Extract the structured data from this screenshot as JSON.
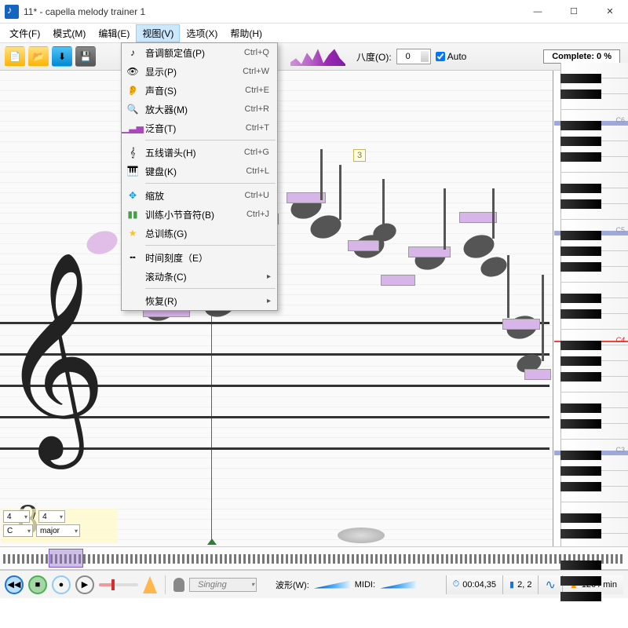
{
  "window": {
    "title": "11* - capella melody trainer 1"
  },
  "menubar": {
    "file": "文件(F)",
    "mode": "模式(M)",
    "edit": "编辑(E)",
    "view": "视图(V)",
    "options": "选项(X)",
    "help": "帮助(H)"
  },
  "toolbar": {
    "octave_label": "八度(O):",
    "octave_value": "0",
    "auto_label": "Auto",
    "complete": "Complete: 0 %"
  },
  "yellow_marker": "3",
  "piano_labels": {
    "c6": "C6",
    "c5": "C5",
    "c4": "C4",
    "c3": "C3"
  },
  "timesig": {
    "num": "4",
    "den": "4",
    "eight": "8",
    "key": "C",
    "mode": "major"
  },
  "statusbar": {
    "singing": "Singing",
    "wave_label": "波形(W):",
    "midi_label": "MIDI:",
    "time": "00:04,35",
    "bars": "2, 2",
    "tempo": "126 / min"
  },
  "view_menu": {
    "pitch": {
      "label": "音调额定值(P)",
      "sc": "Ctrl+Q"
    },
    "display": {
      "label": "显示(P)",
      "sc": "Ctrl+W"
    },
    "voice": {
      "label": "声音(S)",
      "sc": "Ctrl+E"
    },
    "magnifier": {
      "label": "放大器(M)",
      "sc": "Ctrl+R"
    },
    "overtones": {
      "label": "泛音(T)",
      "sc": "Ctrl+T"
    },
    "staff_head": {
      "label": "五线谱头(H)",
      "sc": "Ctrl+G"
    },
    "keyboard": {
      "label": "键盘(K)",
      "sc": "Ctrl+L"
    },
    "zoom": {
      "label": "缩放",
      "sc": "Ctrl+U"
    },
    "train_notes": {
      "label": "训练小节音符(B)",
      "sc": "Ctrl+J"
    },
    "total_train": {
      "label": "总训练(G)",
      "sc": ""
    },
    "timescale": {
      "label": "时间刻度（E）",
      "sc": ""
    },
    "scrollbar": {
      "label": "滚动条(C)",
      "sc": ""
    },
    "restore": {
      "label": "恢复(R)",
      "sc": ""
    }
  }
}
